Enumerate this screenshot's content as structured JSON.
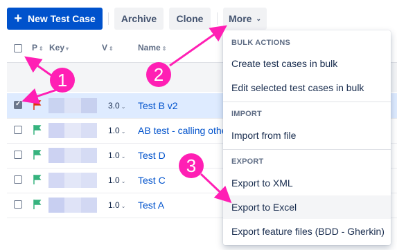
{
  "toolbar": {
    "new_label": "New Test Case",
    "archive_label": "Archive",
    "clone_label": "Clone",
    "more_label": "More"
  },
  "table": {
    "headers": {
      "priority": "P",
      "key": "Key",
      "version": "V",
      "name": "Name"
    },
    "rows": [
      {
        "version": "3.0",
        "name": "Test B v2",
        "checked": true,
        "flag_color": "#de350b"
      },
      {
        "version": "1.0",
        "name": "AB test - calling othe",
        "checked": false,
        "flag_color": "#36b37e"
      },
      {
        "version": "1.0",
        "name": "Test D",
        "checked": false,
        "flag_color": "#36b37e"
      },
      {
        "version": "1.0",
        "name": "Test C",
        "checked": false,
        "flag_color": "#36b37e"
      },
      {
        "version": "1.0",
        "name": "Test A",
        "checked": false,
        "flag_color": "#36b37e"
      }
    ]
  },
  "menu": {
    "bulk_title": "BULK ACTIONS",
    "bulk_items": [
      "Create test cases in bulk",
      "Edit selected test cases in bulk"
    ],
    "import_title": "IMPORT",
    "import_items": [
      "Import from file"
    ],
    "export_title": "EXPORT",
    "export_items": [
      "Export to XML",
      "Export to Excel",
      "Export feature files (BDD - Gherkin)"
    ],
    "hovered_item": "Export to Excel"
  },
  "annotations": {
    "badge1": "1",
    "badge2": "2",
    "badge3": "3"
  },
  "colors": {
    "primary": "#0052cc",
    "annotation": "#ff1fb4",
    "selected_row": "#deebff",
    "link": "#0052cc"
  }
}
